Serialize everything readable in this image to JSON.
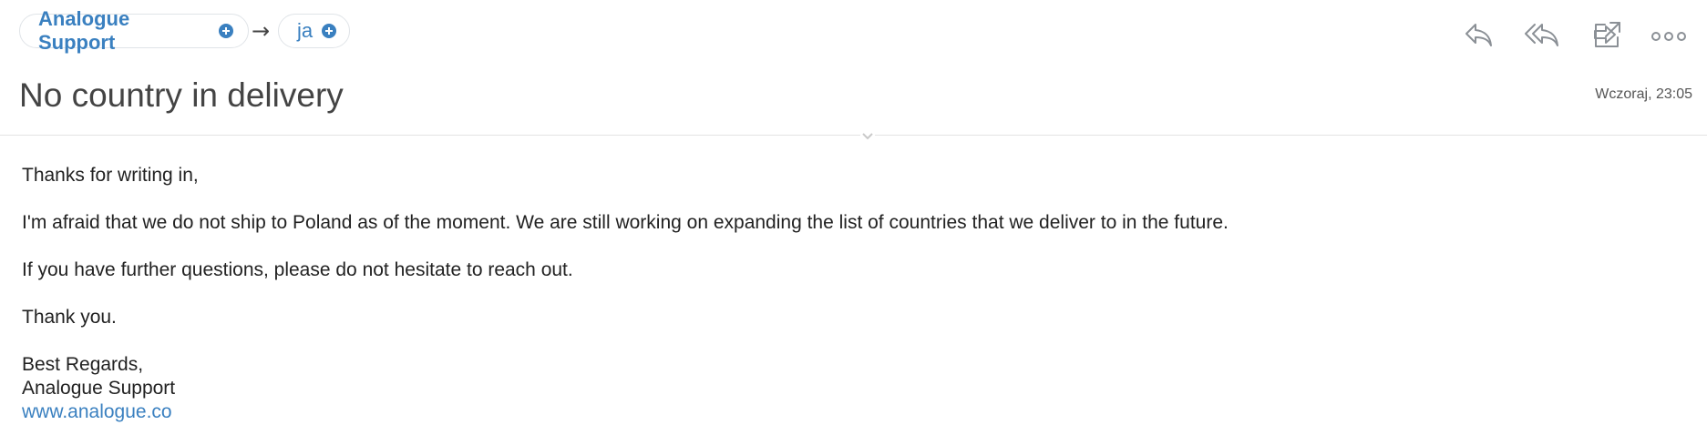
{
  "header": {
    "sender": "Analogue Support",
    "arrow": "→",
    "recipient": "ja"
  },
  "toolbar": {
    "icons": [
      "reply-icon",
      "reply-all-icon",
      "forward-icon",
      "open-external-icon",
      "more-icon"
    ]
  },
  "message": {
    "subject": "No country in delivery",
    "date": "Wczoraj, 23:05",
    "greeting": "Thanks for writing in,",
    "paragraph_1": "I'm afraid that we do not ship to Poland as of the moment. We are still working on expanding the list of countries that we deliver to in the future.",
    "paragraph_2": "If you have further questions, please do not hesitate to reach out.",
    "paragraph_3": "Thank you.",
    "signature": {
      "closing": "Best Regards,",
      "name": "Analogue Support",
      "link": "www.analogue.co"
    }
  },
  "colors": {
    "accent": "#3a80c0",
    "icon": "#8b9096",
    "subject": "#444444"
  }
}
